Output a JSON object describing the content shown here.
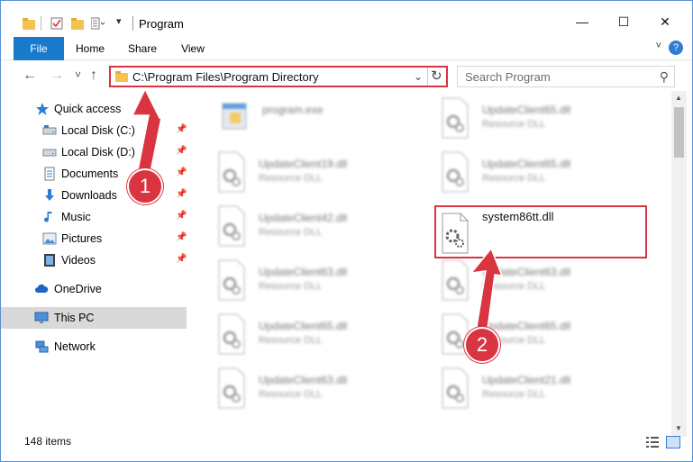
{
  "window": {
    "title": "Program",
    "controls": {
      "minimize": "—",
      "maximize": "☐",
      "close": "✕"
    }
  },
  "ribbon": {
    "tabs": [
      {
        "label": "File",
        "active": true
      },
      {
        "label": "Home"
      },
      {
        "label": "Share"
      },
      {
        "label": "View"
      }
    ],
    "help": "?"
  },
  "nav": {
    "back": "←",
    "forward": "→",
    "recent": "˅",
    "up": "↑",
    "address": "C:\\Program Files\\Program Directory",
    "search_placeholder": "Search Program"
  },
  "sidebar": {
    "items": [
      {
        "label": "Quick access",
        "icon": "star-icon",
        "pinned": false
      },
      {
        "label": "Local Disk (C:)",
        "icon": "drive-icon",
        "pinned": true
      },
      {
        "label": "Local Disk (D:)",
        "icon": "drive-icon",
        "pinned": true
      },
      {
        "label": "Documents",
        "icon": "documents-icon",
        "pinned": true
      },
      {
        "label": "Downloads",
        "icon": "download-icon",
        "pinned": true
      },
      {
        "label": "Music",
        "icon": "music-icon",
        "pinned": true
      },
      {
        "label": "Pictures",
        "icon": "pictures-icon",
        "pinned": true
      },
      {
        "label": "Videos",
        "icon": "videos-icon",
        "pinned": true
      },
      {
        "label": "OneDrive",
        "icon": "cloud-icon",
        "pinned": false
      },
      {
        "label": "This PC",
        "icon": "monitor-icon",
        "pinned": false,
        "selected": true
      },
      {
        "label": "Network",
        "icon": "network-icon",
        "pinned": false
      }
    ]
  },
  "files": [
    {
      "name": "program.exe",
      "desc": "",
      "type": "exe"
    },
    {
      "name": "UpdateClient65.dll",
      "desc": "Resource DLL",
      "type": "dll"
    },
    {
      "name": "UpdateClient19.dll",
      "desc": "Resource DLL",
      "type": "dll"
    },
    {
      "name": "UpdateClient65.dll",
      "desc": "Resource DLL",
      "type": "dll"
    },
    {
      "name": "UpdateClient42.dll",
      "desc": "Resource DLL",
      "type": "dll"
    },
    {
      "name": "system86tt.dll",
      "desc": "",
      "type": "dll",
      "highlighted": true
    },
    {
      "name": "UpdateClient63.dll",
      "desc": "Resource DLL",
      "type": "dll"
    },
    {
      "name": "UpdateClient63.dll",
      "desc": "Resource DLL",
      "type": "dll"
    },
    {
      "name": "UpdateClient65.dll",
      "desc": "Resource DLL",
      "type": "dll"
    },
    {
      "name": "UpdateClient65.dll",
      "desc": "Resource DLL",
      "type": "dll"
    },
    {
      "name": "UpdateClient63.dll",
      "desc": "Resource DLL",
      "type": "dll"
    },
    {
      "name": "UpdateClient21.dll",
      "desc": "Resource DLL",
      "type": "dll"
    }
  ],
  "status": {
    "items_count": "148 items"
  },
  "annotations": [
    {
      "number": "1"
    },
    {
      "number": "2"
    }
  ],
  "colors": {
    "accent": "#1979ca",
    "annotation": "#d9343f"
  }
}
